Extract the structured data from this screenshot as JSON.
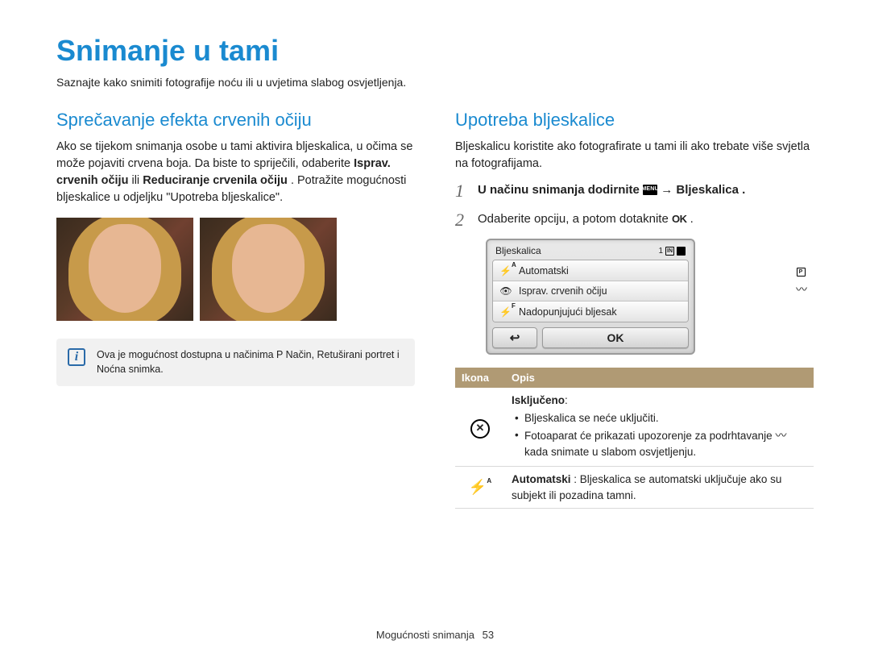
{
  "title": "Snimanje u tami",
  "subtitle": "Saznajte kako snimiti fotografije noću ili u uvjetima slabog osvjetljenja.",
  "left": {
    "heading": "Sprečavanje efekta crvenih očiju",
    "p1_a": "Ako se tijekom snimanja osobe u tami aktivira bljeskalica, u očima se može pojaviti crvena boja. Da biste to spriječili, odaberite ",
    "p1_b1": "Isprav. crvenih očiju",
    "p1_or": " ili ",
    "p1_b2": "Reduciranje crvenila očiju",
    "p1_c": ". Potražite mogućnosti bljeskalice u odjeljku \"Upotreba bljeskalice\".",
    "note": "Ova je mogućnost dostupna u načinima P Način, Retuširani portret i Noćna snimka."
  },
  "right": {
    "heading": "Upotreba bljeskalice",
    "p1": "Bljeskalicu koristite ako fotografirate u tami ili ako trebate više svjetla na fotografijama.",
    "step1_a": "U načinu snimanja dodirnite ",
    "step1_menu": "MENU",
    "step1_b": " → ",
    "step1_bold": "Bljeskalica",
    "step1_c": ".",
    "step2_a": "Odaberite opciju, a potom dotaknite ",
    "step2_ok": "OK",
    "step2_b": ".",
    "lcd": {
      "title": "Bljeskalica",
      "count": "1",
      "items": [
        "Automatski",
        "Isprav. crvenih očiju",
        "Nadopunjujući bljesak"
      ],
      "back": "↩",
      "ok": "OK"
    },
    "table": {
      "h1": "Ikona",
      "h2": "Opis",
      "row1": {
        "title": "Isključeno",
        "b1": "Bljeskalica se neće uključiti.",
        "b2a": "Fotoaparat će prikazati upozorenje za podrhtavanje ",
        "b2b": " kada snimate u slabom osvjetljenju."
      },
      "row2": {
        "bold": "Automatski",
        "rest": ": Bljeskalica se automatski uključuje ako su subjekt ili pozadina tamni."
      }
    }
  },
  "footer": {
    "section": "Mogućnosti snimanja",
    "page": "53"
  }
}
